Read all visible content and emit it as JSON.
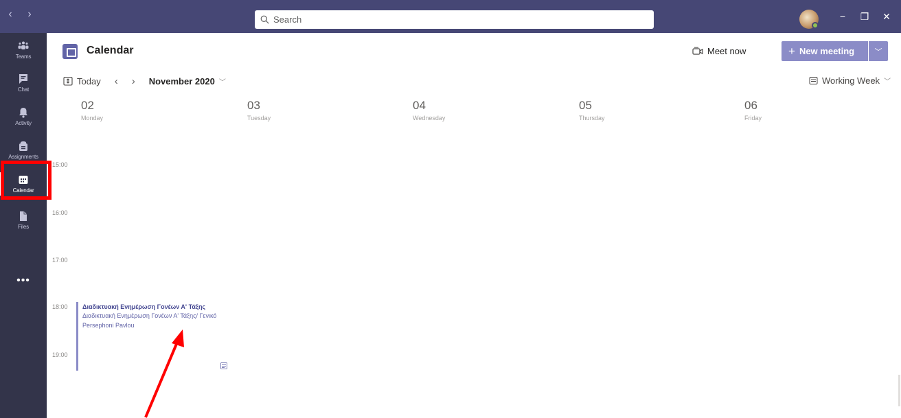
{
  "titlebar": {
    "back": "‹",
    "forward": "›",
    "search_placeholder": "Search",
    "minimize": "−",
    "maximize": "❐",
    "close": "✕",
    "bg_color": "#464775"
  },
  "rail": {
    "items": [
      {
        "label": "Teams",
        "icon": "teams-icon"
      },
      {
        "label": "Chat",
        "icon": "chat-icon"
      },
      {
        "label": "Activity",
        "icon": "bell-icon"
      },
      {
        "label": "Assignments",
        "icon": "assignments-icon"
      },
      {
        "label": "Calendar",
        "icon": "calendar-icon",
        "active": true
      },
      {
        "label": "Files",
        "icon": "file-icon"
      }
    ],
    "more": "•••"
  },
  "header": {
    "title": "Calendar",
    "meet_now": "Meet now",
    "new_meeting": "New meeting",
    "accent": "#6264a7"
  },
  "toolbar": {
    "today": "Today",
    "prev": "‹",
    "next": "›",
    "month": "November 2020",
    "view": "Working Week"
  },
  "days": [
    {
      "num": "02",
      "name": "Monday"
    },
    {
      "num": "03",
      "name": "Tuesday"
    },
    {
      "num": "04",
      "name": "Wednesday"
    },
    {
      "num": "05",
      "name": "Thursday"
    },
    {
      "num": "06",
      "name": "Friday"
    }
  ],
  "times": [
    "15:00",
    "16:00",
    "17:00",
    "18:00",
    "19:00"
  ],
  "event": {
    "title": "Διαδικτυακή Ενημέρωση Γονέων Α' Τάξης",
    "channel": "Διαδικτυακή Ενημέρωση Γονέων Α' Τάξης/ Γενικό",
    "organizer": "Persephoni Pavlou"
  },
  "annotation": {
    "highlight_color": "#ff0000"
  }
}
